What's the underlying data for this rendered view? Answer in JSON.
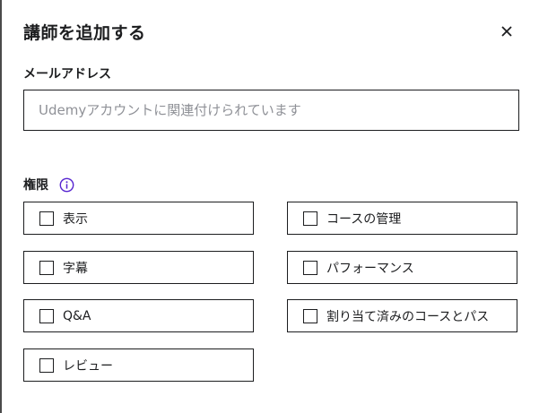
{
  "dialog": {
    "title": "講師を追加する",
    "close_icon": "close-icon"
  },
  "email": {
    "label": "メールアドレス",
    "placeholder": "Udemyアカウントに関連付けられています",
    "value": ""
  },
  "permissions": {
    "label": "権限",
    "info_icon": "info-icon",
    "accent_color": "#5624d0",
    "options": [
      {
        "label": "表示",
        "checked": false
      },
      {
        "label": "コースの管理",
        "checked": false
      },
      {
        "label": "字幕",
        "checked": false
      },
      {
        "label": "パフォーマンス",
        "checked": false
      },
      {
        "label": "Q&A",
        "checked": false
      },
      {
        "label": "割り当て済みのコースとパス",
        "checked": false
      },
      {
        "label": "レビュー",
        "checked": false
      }
    ]
  }
}
